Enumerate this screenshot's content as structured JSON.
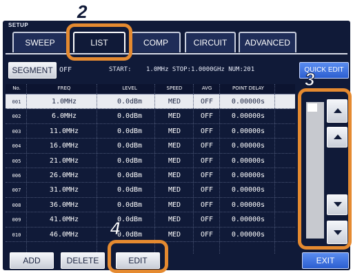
{
  "panel": {
    "title": "SETUP"
  },
  "tabs": [
    {
      "label": "SWEEP",
      "active": false
    },
    {
      "label": "LIST",
      "active": true
    },
    {
      "label": "COMP",
      "active": false
    },
    {
      "label": "CIRCUIT",
      "active": false
    },
    {
      "label": "ADVANCED",
      "active": false
    }
  ],
  "segment": {
    "button_label": "SEGMENT",
    "state": "OFF"
  },
  "sweep_info": {
    "start_label": "START:",
    "range_text": "1.0MHz STOP:1.0000GHz NUM:201"
  },
  "quick_edit": {
    "label": "QUICK EDIT"
  },
  "table": {
    "headers": [
      "No.",
      "FREQ",
      "LEVEL",
      "SPEED",
      "AVG",
      "POINT DELAY"
    ],
    "rows": [
      {
        "no": "001",
        "freq": "1.0MHz",
        "level": "0.0dBm",
        "speed": "MED",
        "avg": "OFF",
        "delay": "0.00000s",
        "selected": true
      },
      {
        "no": "002",
        "freq": "6.0MHz",
        "level": "0.0dBm",
        "speed": "MED",
        "avg": "OFF",
        "delay": "0.00000s"
      },
      {
        "no": "003",
        "freq": "11.0MHz",
        "level": "0.0dBm",
        "speed": "MED",
        "avg": "OFF",
        "delay": "0.00000s"
      },
      {
        "no": "004",
        "freq": "16.0MHz",
        "level": "0.0dBm",
        "speed": "MED",
        "avg": "OFF",
        "delay": "0.00000s"
      },
      {
        "no": "005",
        "freq": "21.0MHz",
        "level": "0.0dBm",
        "speed": "MED",
        "avg": "OFF",
        "delay": "0.00000s"
      },
      {
        "no": "006",
        "freq": "26.0MHz",
        "level": "0.0dBm",
        "speed": "MED",
        "avg": "OFF",
        "delay": "0.00000s"
      },
      {
        "no": "007",
        "freq": "31.0MHz",
        "level": "0.0dBm",
        "speed": "MED",
        "avg": "OFF",
        "delay": "0.00000s"
      },
      {
        "no": "008",
        "freq": "36.0MHz",
        "level": "0.0dBm",
        "speed": "MED",
        "avg": "OFF",
        "delay": "0.00000s"
      },
      {
        "no": "009",
        "freq": "41.0MHz",
        "level": "0.0dBm",
        "speed": "MED",
        "avg": "OFF",
        "delay": "0.00000s"
      },
      {
        "no": "010",
        "freq": "46.0MHz",
        "level": "0.0dBm",
        "speed": "MED",
        "avg": "OFF",
        "delay": "0.00000s"
      }
    ]
  },
  "scroll": {
    "icons": [
      "scroll-page-up-icon",
      "scroll-line-up-icon",
      "scroll-line-down-icon",
      "scroll-page-down-icon"
    ]
  },
  "bottom_buttons": {
    "add": "ADD",
    "delete": "DELETE",
    "edit": "EDIT",
    "exit": "EXIT"
  },
  "annotations": {
    "step_list": "2",
    "step_scroll": "3",
    "step_edit": "4",
    "accent_color": "#e58a30"
  }
}
